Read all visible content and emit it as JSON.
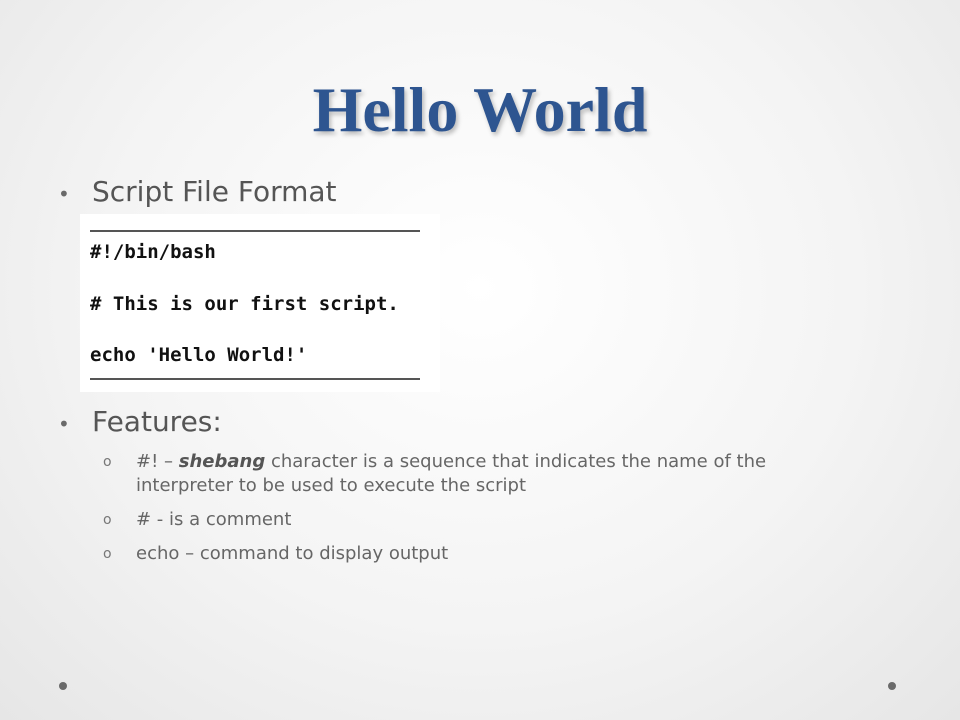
{
  "slide": {
    "title": "Hello World",
    "bullets": [
      {
        "marker": "•",
        "text": "Script File Format"
      },
      {
        "marker": "•",
        "text": "Features:"
      }
    ],
    "code_lines": [
      "#!/bin/bash",
      "# This is our first script.",
      "echo 'Hello World!'"
    ],
    "features": [
      {
        "marker": "o",
        "prefix": "#! – ",
        "emphasis": "shebang",
        "suffix": " character is a sequence that indicates the name of the interpreter to be used to execute the script"
      },
      {
        "marker": "o",
        "prefix": "# - is a comment",
        "emphasis": "",
        "suffix": ""
      },
      {
        "marker": "o",
        "prefix": "echo – command to display output",
        "emphasis": "",
        "suffix": ""
      }
    ]
  },
  "colors": {
    "title": "#2e5590",
    "body_text": "#555555",
    "sub_text": "#666666"
  }
}
